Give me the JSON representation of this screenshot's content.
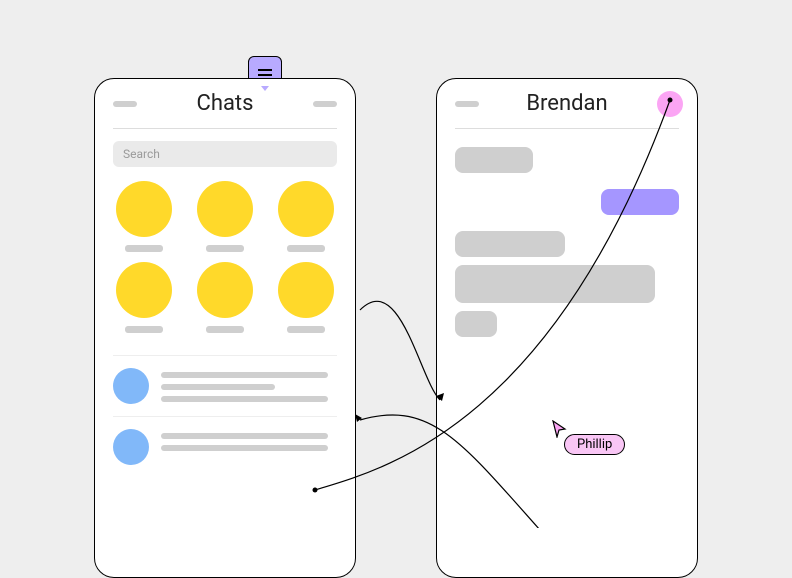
{
  "left": {
    "title": "Chats",
    "search_placeholder": "Search"
  },
  "right": {
    "title": "Brendan"
  },
  "cursor": {
    "label": "Phillip"
  }
}
